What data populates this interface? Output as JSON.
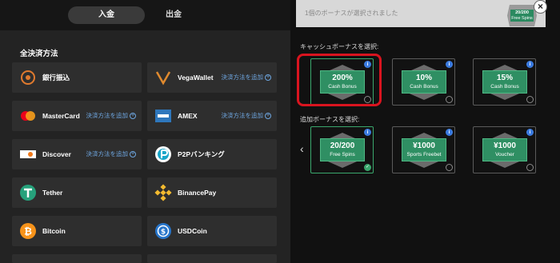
{
  "tabs": {
    "deposit": "入金",
    "withdraw": "出金"
  },
  "methods_title": "全決済方法",
  "add_label": "決済方法を追加",
  "methods": [
    {
      "name": "銀行振込",
      "icon": "bank-transfer-icon"
    },
    {
      "name": "VegaWallet",
      "icon": "vegawallet-icon"
    },
    {
      "name": "MasterCard",
      "icon": "mastercard-icon"
    },
    {
      "name": "AMEX",
      "icon": "amex-icon"
    },
    {
      "name": "Discover",
      "icon": "discover-icon"
    },
    {
      "name": "P2Pバンキング",
      "icon": "p2p-icon"
    },
    {
      "name": "Tether",
      "icon": "tether-icon"
    },
    {
      "name": "BinancePay",
      "icon": "binance-icon"
    },
    {
      "name": "Bitcoin",
      "icon": "bitcoin-icon"
    },
    {
      "name": "USDCoin",
      "icon": "usdcoin-icon"
    }
  ],
  "selected_notice": "1個のボーナスが選択されました",
  "mini_card": {
    "value": "20/200",
    "sub": "Free Spins"
  },
  "cash_label": "キャッシュボーナスを選択:",
  "extra_label": "追加ボーナスを選択:",
  "cash_bonuses": [
    {
      "value": "200%",
      "sub": "Cash Bonus"
    },
    {
      "value": "10%",
      "sub": "Cash Bonus"
    },
    {
      "value": "15%",
      "sub": "Cash Bonus"
    }
  ],
  "extra_bonuses": [
    {
      "value": "20/200",
      "sub": "Free Spins"
    },
    {
      "value": "¥1000",
      "sub": "Sports Freebet"
    },
    {
      "value": "¥1000",
      "sub": "Voucher"
    }
  ],
  "colors": {
    "accent_green": "#2f8f63",
    "link_blue": "#6ea6e0",
    "highlight_red": "#d9141f",
    "info_blue": "#3b7be0"
  }
}
